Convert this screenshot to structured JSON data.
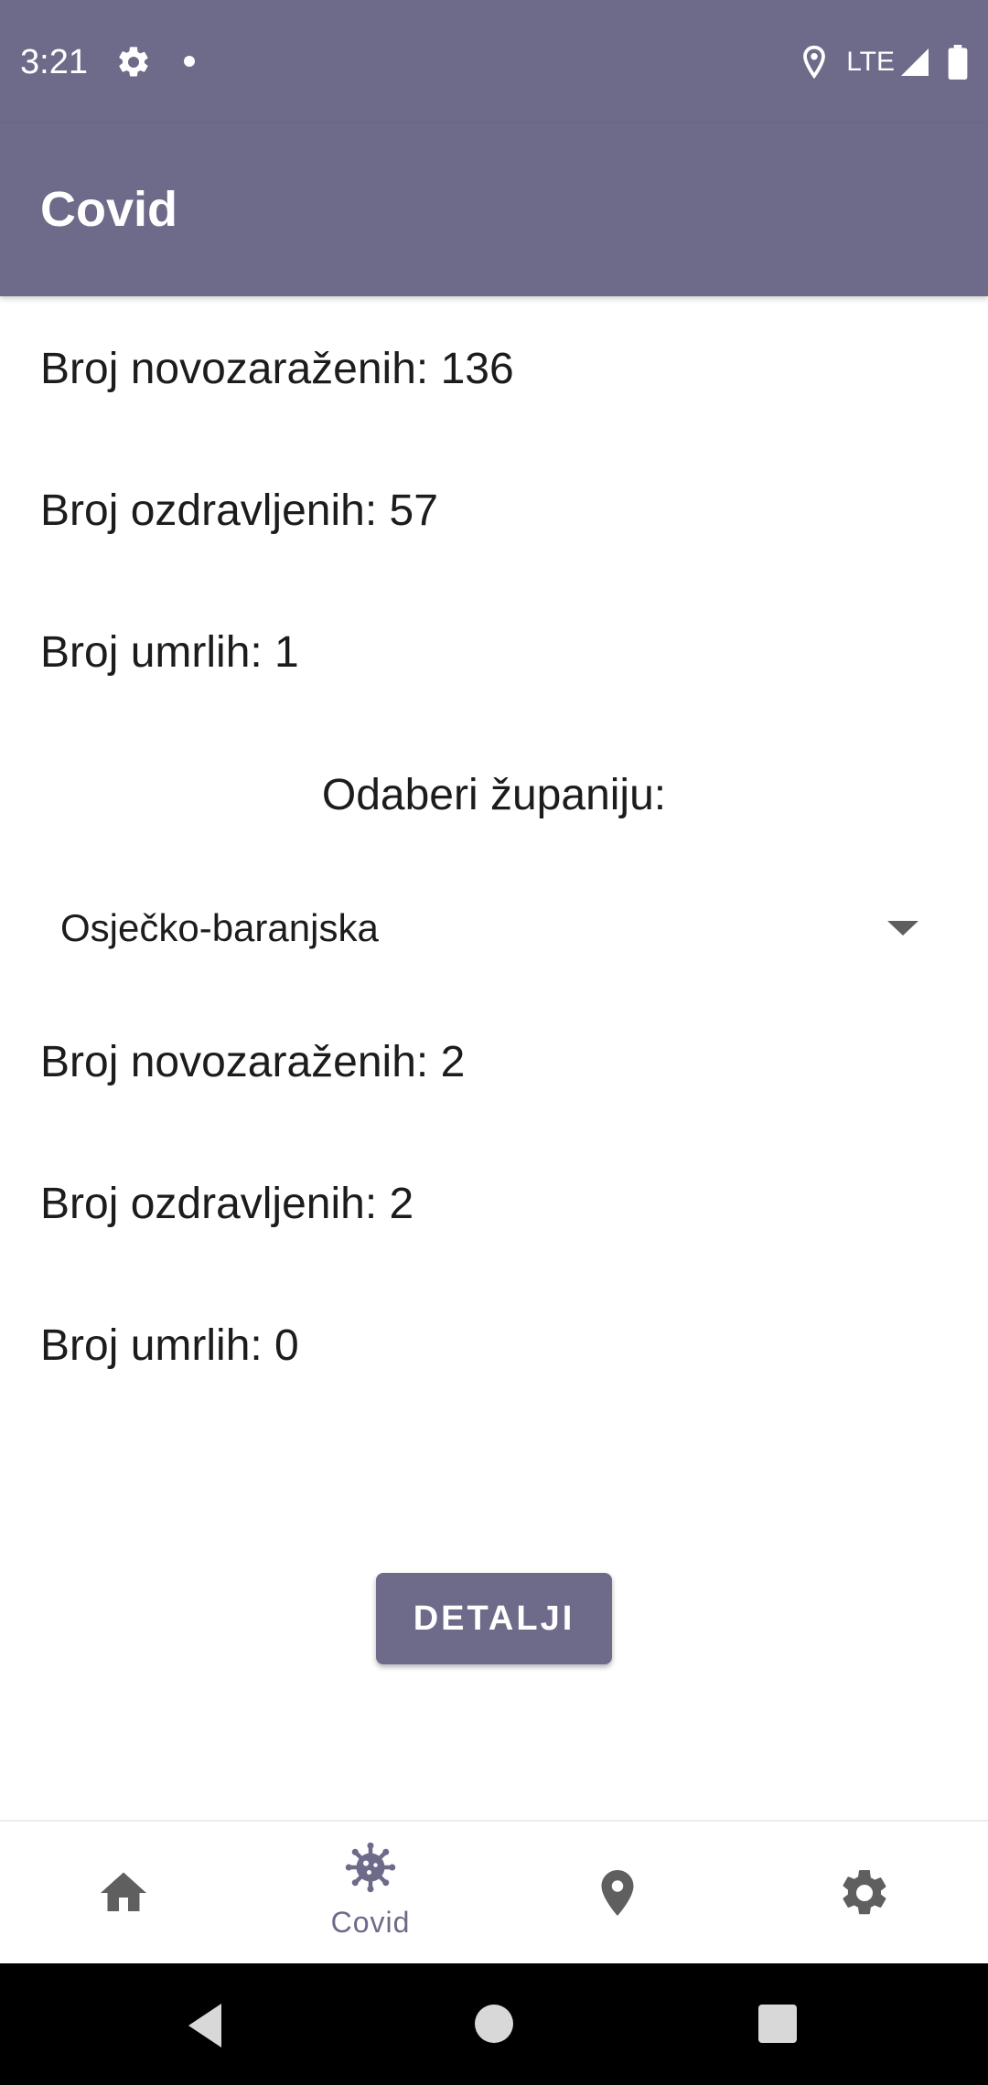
{
  "status_bar": {
    "time": "3:21",
    "network": "LTE",
    "icons": [
      "gear-icon",
      "notification-dot",
      "location-icon",
      "signal-icon",
      "battery-icon"
    ]
  },
  "app_bar": {
    "title": "Covid"
  },
  "national": {
    "new_cases": "Broj novozaraženih: 136",
    "recovered": "Broj ozdravljenih: 57",
    "deaths": "Broj umrlih: 1"
  },
  "county_prompt": "Odaberi županiju:",
  "county_select": {
    "selected": "Osječko-baranjska"
  },
  "county": {
    "new_cases": "Broj novozaraženih: 2",
    "recovered": "Broj ozdravljenih: 2",
    "deaths": "Broj umrlih: 0"
  },
  "details_button": "DETALJI",
  "bottom_nav": {
    "items": [
      {
        "icon": "home-icon",
        "label": ""
      },
      {
        "icon": "virus-icon",
        "label": "Covid",
        "active": true
      },
      {
        "icon": "location-pin-icon",
        "label": ""
      },
      {
        "icon": "settings-icon",
        "label": ""
      }
    ]
  },
  "colors": {
    "primary": "#6d6a8a",
    "text": "#1c1c1c",
    "background": "#ffffff"
  }
}
